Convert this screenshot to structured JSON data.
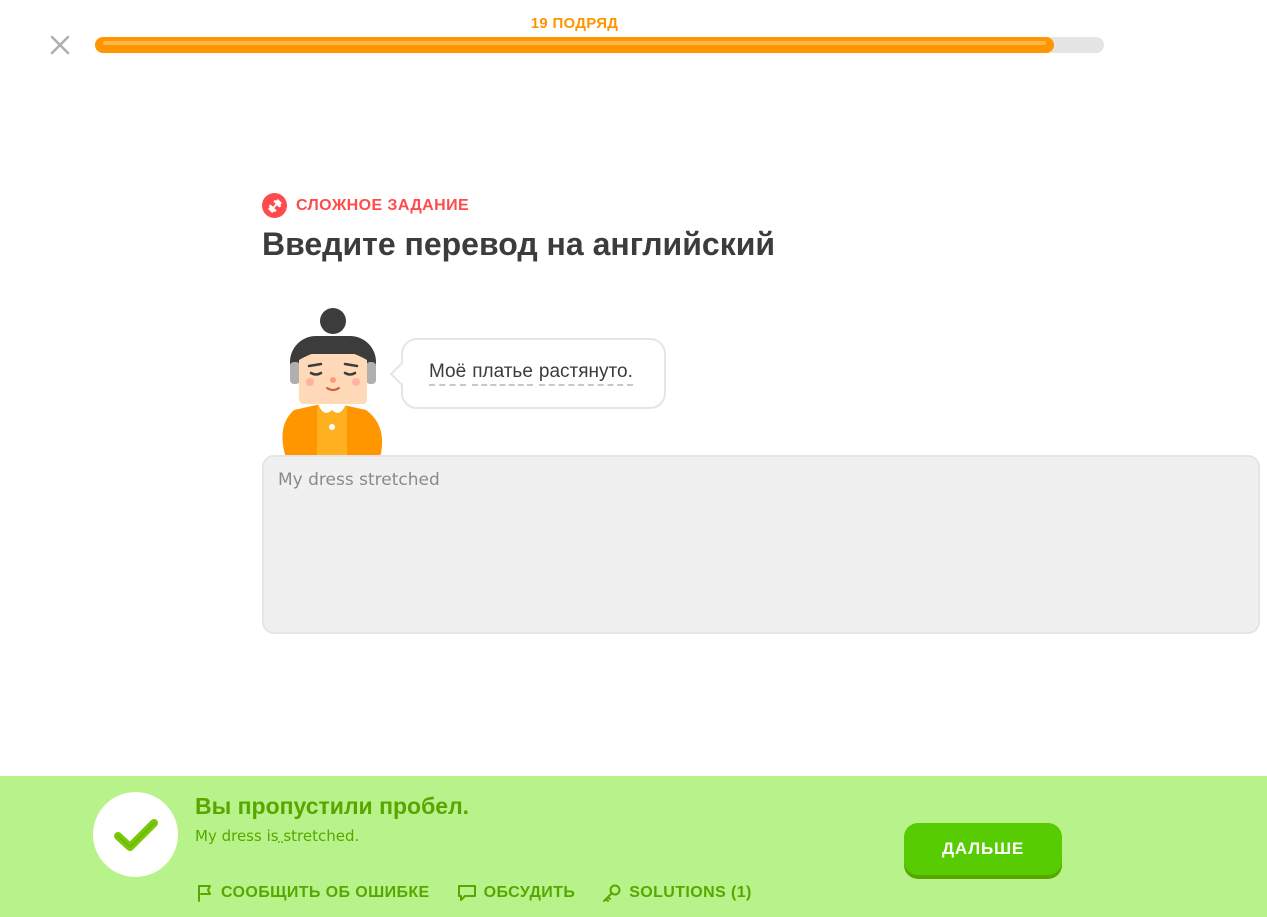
{
  "header": {
    "streak_text": "19 ПОДРЯД",
    "progress": 0.95
  },
  "challenge": {
    "badge_label": "СЛОЖНОЕ ЗАДАНИЕ",
    "instruction": "Введите перевод на английский",
    "prompt_words": [
      "Моё",
      "платье",
      "растянуто."
    ]
  },
  "answer": {
    "value": "My dress stretched"
  },
  "feedback": {
    "title": "Вы пропустили пробел.",
    "answer_before": "My dress is",
    "answer_missing": " ",
    "answer_after": "stretched.",
    "next_label": "ДАЛЬШЕ",
    "report_label": "СООБЩИТЬ ОБ ОШИБКЕ",
    "discuss_label": "ОБСУДИТЬ",
    "solutions_label": "SOLUTIONS (1)"
  },
  "colors": {
    "progress": "#ff9600",
    "hard_badge": "#ff4b4b",
    "correct_bg": "#b8f28b",
    "correct_text": "#58a700",
    "button": "#58cc02"
  },
  "icons": [
    "close-icon",
    "dumbbell-icon",
    "checkmark-icon",
    "flag-icon",
    "comment-icon",
    "key-icon"
  ]
}
